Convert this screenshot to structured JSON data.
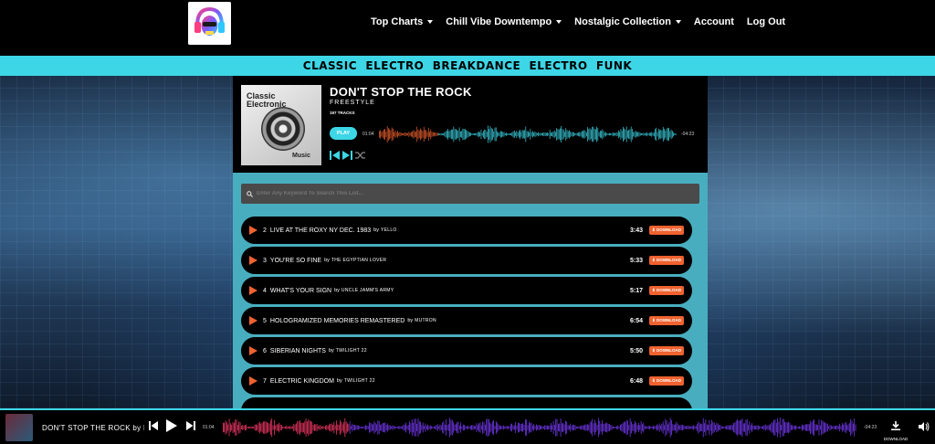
{
  "header": {
    "logo_icon": "headphone-skull-logo-icon",
    "nav": [
      {
        "label": "Top Charts",
        "dropdown": true
      },
      {
        "label": "Chill Vibe Downtempo",
        "dropdown": true
      },
      {
        "label": "Nostalgic Collection",
        "dropdown": true
      },
      {
        "label": "Account",
        "dropdown": false
      },
      {
        "label": "Log Out",
        "dropdown": false
      }
    ]
  },
  "banner": {
    "text": "CLASSIC  ELECTRO  BREAKDANCE  ELECTRO  FUNK"
  },
  "album": {
    "cover_title": "Classic Electronic",
    "cover_sub": "Music",
    "title": "DON'T STOP THE ROCK",
    "subtitle": "FREESTYLE",
    "tracks_count": "197 TRACKS",
    "play_label": "PLAY",
    "time_current": "01:04",
    "time_remaining": "-04:23",
    "progress": 0.2
  },
  "search": {
    "placeholder": "Enter Any Keyword To Search This List..."
  },
  "tracks": [
    {
      "num": "2",
      "title": "LIVE AT THE ROXY NY DEC. 1983",
      "by": "by",
      "artist": "YELLO",
      "duration": "3:43",
      "download": "DOWNLOAD"
    },
    {
      "num": "3",
      "title": "YOU'RE SO FINE",
      "by": "by",
      "artist": "THE EGYPTIAN LOVER",
      "duration": "5:33",
      "download": "DOWNLOAD"
    },
    {
      "num": "4",
      "title": "WHAT'S YOUR SIGN",
      "by": "by",
      "artist": "UNCLE JAMM'S ARMY",
      "duration": "5:17",
      "download": "DOWNLOAD"
    },
    {
      "num": "5",
      "title": "HOLOGRAMIZED MEMORIES REMASTERED",
      "by": "by",
      "artist": "MUTRON",
      "duration": "6:54",
      "download": "DOWNLOAD"
    },
    {
      "num": "6",
      "title": "SIBERIAN NIGHTS",
      "by": "by",
      "artist": "TWILIGHT 22",
      "duration": "5:50",
      "download": "DOWNLOAD"
    },
    {
      "num": "7",
      "title": "ELECTRIC KINGDOM",
      "by": "by",
      "artist": "TWILIGHT 22",
      "duration": "6:48",
      "download": "DOWNLOAD"
    }
  ],
  "player": {
    "title": "DON'T STOP THE ROCK by FR",
    "time_current": "01:04",
    "time_remaining": "-04:23",
    "download_label": "DOWNLOAD",
    "progress": 0.2
  },
  "colors": {
    "accent_cyan": "#3dd6e6",
    "accent_orange": "#f0622f",
    "wave_pink": "#ff3b6b",
    "wave_purple": "#7b3cff"
  }
}
